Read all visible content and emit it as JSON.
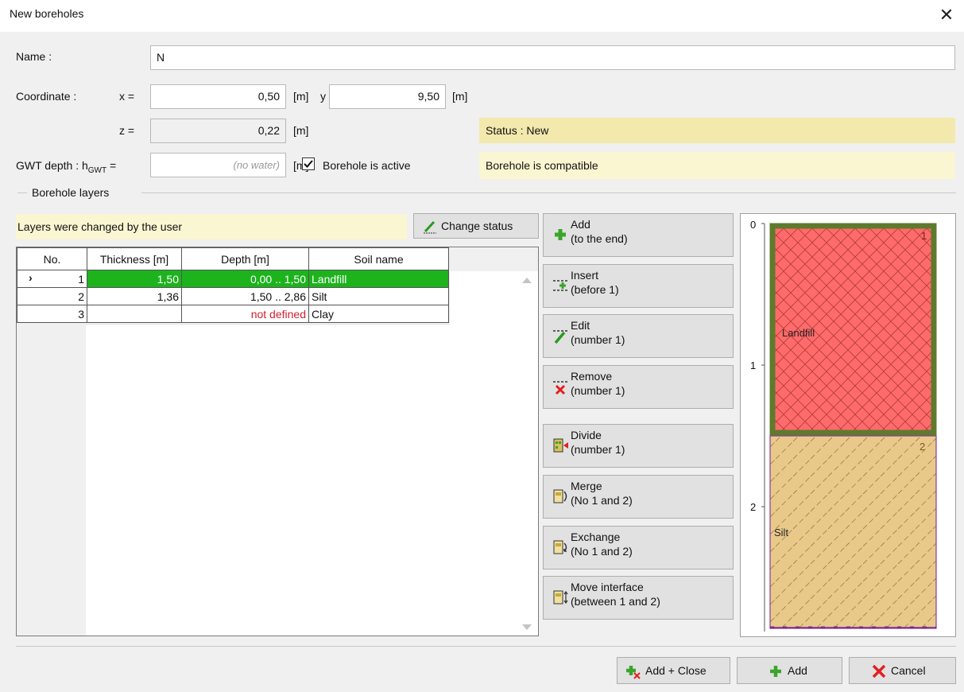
{
  "window": {
    "title": "New boreholes"
  },
  "form": {
    "name_label": "Name :",
    "name_value": "N",
    "coordinate_label": "Coordinate :",
    "x_label": "x =",
    "x_value": "0,50",
    "y_label": "y =",
    "y_value": "9,50",
    "z_label": "z =",
    "z_value": "0,22",
    "unit_m": "[m]",
    "gwt_label": "GWT depth : h",
    "gwt_sub": "GWT",
    "gwt_eq": " =",
    "gwt_placeholder": "(no water)",
    "active_label": "Borehole is active",
    "active_checked": true,
    "status_text": "Status : New",
    "compat_text": "Borehole is compatible"
  },
  "layers": {
    "group_label": "Borehole layers",
    "info_text": "Layers were changed by the user",
    "change_status_label": "Change status",
    "columns": [
      "No.",
      "Thickness [m]",
      "Depth [m]",
      "Soil name"
    ],
    "rows": [
      {
        "no": "1",
        "thickness": "1,50",
        "depth": "0,00 .. 1,50",
        "soil": "Landfill",
        "marker": "›",
        "selected": true
      },
      {
        "no": "2",
        "thickness": "1,36",
        "depth": "1,50 .. 2,86",
        "soil": "Silt",
        "marker": "",
        "selected": false
      },
      {
        "no": "3",
        "thickness": "",
        "depth": "not defined",
        "soil": "Clay",
        "marker": "",
        "selected": false
      }
    ]
  },
  "actions": [
    {
      "line1": "Add",
      "line2": "(to the end)",
      "icon": "plus-icon"
    },
    {
      "line1": "Insert",
      "line2": "(before 1)",
      "icon": "insert-icon"
    },
    {
      "line1": "Edit",
      "line2": "(number 1)",
      "icon": "pencil-icon"
    },
    {
      "line1": "Remove",
      "line2": "(number 1)",
      "icon": "remove-icon"
    },
    {
      "line1": "Divide",
      "line2": "(number 1)",
      "icon": "divide-icon"
    },
    {
      "line1": "Merge",
      "line2": "(No 1 and 2)",
      "icon": "merge-icon"
    },
    {
      "line1": "Exchange",
      "line2": "(No 1 and 2)",
      "icon": "exchange-icon"
    },
    {
      "line1": "Move interface",
      "line2": "(between 1 and 2)",
      "icon": "move-interface-icon"
    }
  ],
  "profile": {
    "ticks": [
      "0",
      "1",
      "2"
    ],
    "layers": [
      {
        "number": "1",
        "name": "Landfill",
        "top": 0.0,
        "bottom": 1.5,
        "fill": "#ff6b6b",
        "border": "#5e7b2c"
      },
      {
        "number": "2",
        "name": "Silt",
        "top": 1.5,
        "bottom": 2.86,
        "fill": "#e8c98a",
        "border": "#8b3a9a"
      }
    ]
  },
  "footer": {
    "add_close_label": "Add + Close",
    "add_label": "Add",
    "cancel_label": "Cancel"
  },
  "colors": {
    "selected_row": "#1db31d",
    "not_defined": "#d0202e",
    "status_bg": "#f4e9ad",
    "info_bg": "#fbf6d2"
  }
}
